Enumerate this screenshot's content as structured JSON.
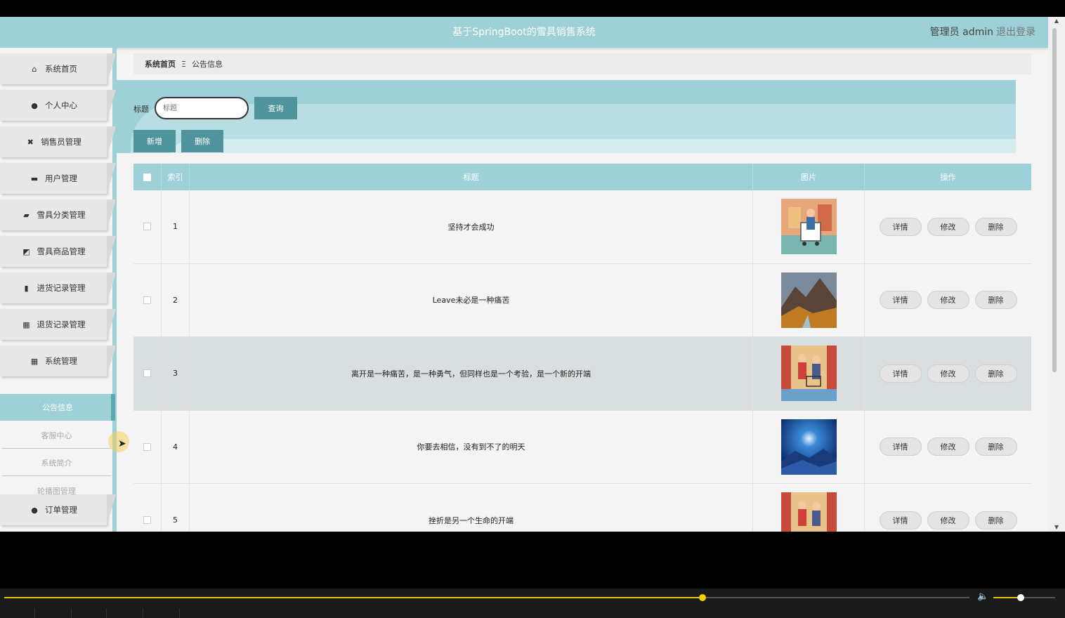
{
  "header": {
    "title": "基于SpringBoot的雪具销售系统",
    "user": "管理员 admin",
    "logout": "退出登录"
  },
  "sidebar": {
    "items": [
      {
        "label": "系统首页",
        "icon": "home-icon",
        "glyph": "⌂"
      },
      {
        "label": "个人中心",
        "icon": "user-icon",
        "glyph": "👤"
      },
      {
        "label": "销售员管理",
        "icon": "ticket-icon",
        "glyph": "✖"
      },
      {
        "label": "用户管理",
        "icon": "chat-icon",
        "glyph": "▬"
      },
      {
        "label": "雪具分类管理",
        "icon": "briefcase-icon",
        "glyph": "▰"
      },
      {
        "label": "雪具商品管理",
        "icon": "chart-icon",
        "glyph": "◩"
      },
      {
        "label": "进货记录管理",
        "icon": "clipboard-icon",
        "glyph": "▮"
      },
      {
        "label": "退货记录管理",
        "icon": "grid-icon",
        "glyph": "▦"
      },
      {
        "label": "系统管理",
        "icon": "grid-icon",
        "glyph": "▦"
      },
      {
        "label": "订单管理",
        "icon": "user-icon",
        "glyph": "👤"
      }
    ],
    "sub_items": [
      "公告信息",
      "客服中心",
      "系统简介",
      "轮播图管理"
    ]
  },
  "breadcrumb": {
    "home": "系统首页",
    "sep": "Ξ",
    "current": "公告信息"
  },
  "search": {
    "label": "标题",
    "placeholder": "标题",
    "query_button": "查询"
  },
  "actions": {
    "add": "新增",
    "delete": "删除"
  },
  "table": {
    "headers": [
      "索引",
      "标题",
      "图片",
      "操作"
    ],
    "row_actions": [
      "详情",
      "修改",
      "删除"
    ],
    "rows": [
      {
        "index": "1",
        "title": "坚持才会成功"
      },
      {
        "index": "2",
        "title": "Leave未必是一种痛苦"
      },
      {
        "index": "3",
        "title": "离开是一种痛苦，是一种勇气，但同样也是一个考验，是一个新的开端"
      },
      {
        "index": "4",
        "title": "你要去相信，没有到不了的明天"
      },
      {
        "index": "5",
        "title": "挫折是另一个生命的开端"
      }
    ]
  },
  "player": {
    "progress": 0.72,
    "volume": 0.4
  },
  "colors": {
    "accent": "#9dd0d7",
    "button": "#4f939c"
  }
}
